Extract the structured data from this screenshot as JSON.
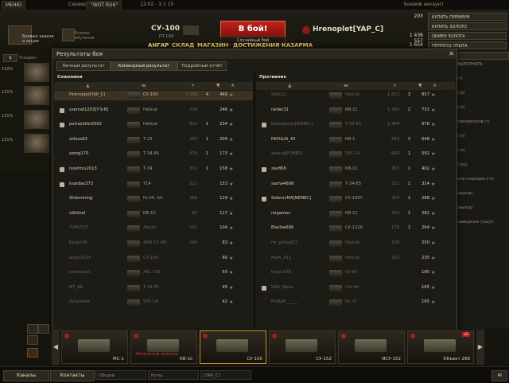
{
  "topbar": {
    "menu_label": "МЕНЮ",
    "server_label": "Сервер:",
    "server_value": "\"WOT RU6\"",
    "time": "12:02 - 3.1 15",
    "battle_account_label": "Боевой аккаунт"
  },
  "header": {
    "left_tile_1": "Боевые задачи и акции",
    "left_tile_2": "Боевое обучение",
    "vehicle_name": "СУ-100",
    "vehicle_class": "ПТ-САУ",
    "battle_button": "В бой!",
    "battle_mode": "Случайный бой",
    "player_name": "Hrenoplet[YAP_C]",
    "currency": [
      {
        "value": "203",
        "action": "КУПИТЬ ПРЕМИУМ"
      },
      {
        "value": "",
        "action": "КУПИТЬ ЗОЛОТО"
      },
      {
        "value": "1 438 557",
        "action": "ОБМЕН ЗОЛОТА"
      },
      {
        "value": "1 654",
        "action": "ПЕРЕВОД ОПЫТА"
      }
    ]
  },
  "nav": [
    "АНГАР",
    "СКЛАД",
    "МАГАЗИН",
    "ДОСТИЖЕНИЯ",
    "КАЗАРМА"
  ],
  "left": {
    "pct": [
      "110%",
      "121%",
      "121%",
      "121%"
    ],
    "ux_label": "Ускорен"
  },
  "dialog": {
    "title": "Результаты боя",
    "tabs": [
      "Личный результат",
      "Командный результат",
      "Подробный отчёт"
    ],
    "active_tab": 1,
    "allies_title": "Союзники",
    "enemies_title": "Противник",
    "allies": [
      {
        "name": "Hrenoplet[YAP_C]",
        "tank": "СУ-100",
        "dmg": "1 369",
        "kills": "4",
        "xp": "469",
        "me": true,
        "platoon": false,
        "dead": false
      },
      {
        "name": "sxemat1203[Y-S-B]",
        "tank": "Hellcat",
        "dmg": "704",
        "kills": "",
        "xp": "246",
        "me": false,
        "platoon": true,
        "dead": false
      },
      {
        "name": "potrashitel2002",
        "tank": "Hellcat",
        "dmg": "621",
        "kills": "1",
        "xp": "234",
        "me": false,
        "platoon": true,
        "dead": false
      },
      {
        "name": "shlexs83",
        "tank": "Т-25",
        "dmg": "250",
        "kills": "1",
        "xp": "209",
        "me": false,
        "platoon": false,
        "dead": false
      },
      {
        "name": "serog170",
        "tank": "Т-34-85",
        "dmg": "474",
        "kills": "1",
        "xp": "173",
        "me": false,
        "platoon": false,
        "dead": false
      },
      {
        "name": "nisshtcu2013",
        "tank": "Т-34",
        "dmg": "332",
        "kills": "1",
        "xp": "158",
        "me": false,
        "platoon": true,
        "dead": false
      },
      {
        "name": "ksardas373",
        "tank": "T14",
        "dmg": "311",
        "kills": "",
        "xp": "153",
        "me": false,
        "platoon": true,
        "dead": false
      },
      {
        "name": "Shlemming",
        "tank": "Pz.Sfl. IVc",
        "dmg": "268",
        "kills": "",
        "xp": "129",
        "me": false,
        "platoon": false,
        "dead": false
      },
      {
        "name": "sShkhel",
        "tank": "КВ-1С",
        "dmg": "83",
        "kills": "",
        "xp": "117",
        "me": false,
        "platoon": false,
        "dead": false
      },
      {
        "name": "TUPOTUT",
        "tank": "Alecto",
        "dmg": "151",
        "kills": "",
        "xp": "104",
        "me": false,
        "platoon": false,
        "dead": true
      },
      {
        "name": "Kaspir26",
        "tank": "AMX 13 AM",
        "dmg": "190",
        "kills": "",
        "xp": "83",
        "me": false,
        "platoon": false,
        "dead": true
      },
      {
        "name": "alegz2013",
        "tank": "СУ-100",
        "dmg": "",
        "kills": "",
        "xp": "60",
        "me": false,
        "platoon": false,
        "dead": true
      },
      {
        "name": "konkovaol",
        "tank": "ARL V39",
        "dmg": "",
        "kills": "",
        "xp": "50",
        "me": false,
        "platoon": false,
        "dead": true
      },
      {
        "name": "MT_86",
        "tank": "Т-34-85",
        "dmg": "",
        "kills": "",
        "xp": "45",
        "me": false,
        "platoon": false,
        "dead": true
      },
      {
        "name": "dydyledor",
        "tank": "S35 CA",
        "dmg": "",
        "kills": "",
        "xp": "42",
        "me": false,
        "platoon": false,
        "dead": true
      }
    ],
    "enemies": [
      {
        "name": "Slick22",
        "tank": "Hellcat",
        "dmg": "1 813",
        "kills": "3",
        "xp": "857",
        "platoon": false,
        "dead": true
      },
      {
        "name": "raider31",
        "tank": "КВ-1С",
        "dmg": "1 380",
        "kills": "2",
        "xp": "731",
        "platoon": false,
        "dead": false
      },
      {
        "name": "bozhgtnyer[NEMEC]",
        "tank": "Т-34-85",
        "dmg": "1 404",
        "kills": "",
        "xp": "676",
        "platoon": true,
        "dead": true
      },
      {
        "name": "PAPULIA_43",
        "tank": "КВ-1",
        "dmg": "643",
        "kills": "3",
        "xp": "648",
        "platoon": false,
        "dead": false
      },
      {
        "name": "xessua[FUNER]",
        "tank": "S35 CA",
        "dmg": "648",
        "kills": "1",
        "xp": "592",
        "platoon": false,
        "dead": true
      },
      {
        "name": "zav866",
        "tank": "КВ-1С",
        "dmg": "455",
        "kills": "1",
        "xp": "402",
        "platoon": true,
        "dead": false
      },
      {
        "name": "sasha4698",
        "tank": "Т-34-85",
        "dmg": "212",
        "kills": "1",
        "xp": "314",
        "platoon": false,
        "dead": false
      },
      {
        "name": "SidorovMA[NEMEC]",
        "tank": "СУ-100Y",
        "dmg": "414",
        "kills": "1",
        "xp": "288",
        "platoon": true,
        "dead": false
      },
      {
        "name": "migamen",
        "tank": "КВ-1С",
        "dmg": "255",
        "kills": "1",
        "xp": "282",
        "platoon": false,
        "dead": false
      },
      {
        "name": "Blackw666",
        "tank": "СУ-122A",
        "dmg": "178",
        "kills": "1",
        "xp": "264",
        "platoon": false,
        "dead": false
      },
      {
        "name": "mr_prihod72",
        "tank": "Hellcat",
        "dmg": "238",
        "kills": "",
        "xp": "250",
        "platoon": false,
        "dead": true
      },
      {
        "name": "Mark_411",
        "tank": "Hellcat",
        "dmg": "233",
        "kills": "",
        "xp": "235",
        "platoon": false,
        "dead": true
      },
      {
        "name": "bogsck78",
        "tank": "СУ-85",
        "dmg": "",
        "kills": "",
        "xp": "185",
        "platoon": false,
        "dead": true
      },
      {
        "name": "VSN_Weex",
        "tank": "Chi-He",
        "dmg": "",
        "kills": "",
        "xp": "165",
        "platoon": true,
        "dead": true
      },
      {
        "name": "ProRoK______",
        "tank": "Pz. IV",
        "dmg": "",
        "kills": "",
        "xp": "165",
        "platoon": false,
        "dead": true
      }
    ]
  },
  "right_strip": [
    "ВЫПОЛНИТЬ",
    "(т)",
    "(гр)",
    "(гп)",
    "боеприпасов (т)",
    "(гп)",
    "(гп)",
    "(грц)",
    "аты снарядов (гп)",
    "(выход)",
    "(выход)",
    "наведения (грц/с)"
  ],
  "carousel": [
    {
      "name": "МС-1",
      "warning": "",
      "badge": "",
      "selected": false
    },
    {
      "name": "КВ-1С",
      "warning": "Неполный экипаж",
      "badge": "",
      "selected": false
    },
    {
      "name": "СУ-100",
      "warning": "",
      "badge": "",
      "selected": true
    },
    {
      "name": "СУ-152",
      "warning": "",
      "badge": "",
      "selected": false
    },
    {
      "name": "ИСУ-152",
      "warning": "",
      "badge": "",
      "selected": false
    },
    {
      "name": "Объект 268",
      "warning": "",
      "badge": "x2",
      "selected": false
    }
  ],
  "bottom": {
    "channels": "Каналы",
    "contacts": "Контакты",
    "field1": "Общий",
    "field2": "Роты",
    "field3": "[YAP_C]"
  }
}
